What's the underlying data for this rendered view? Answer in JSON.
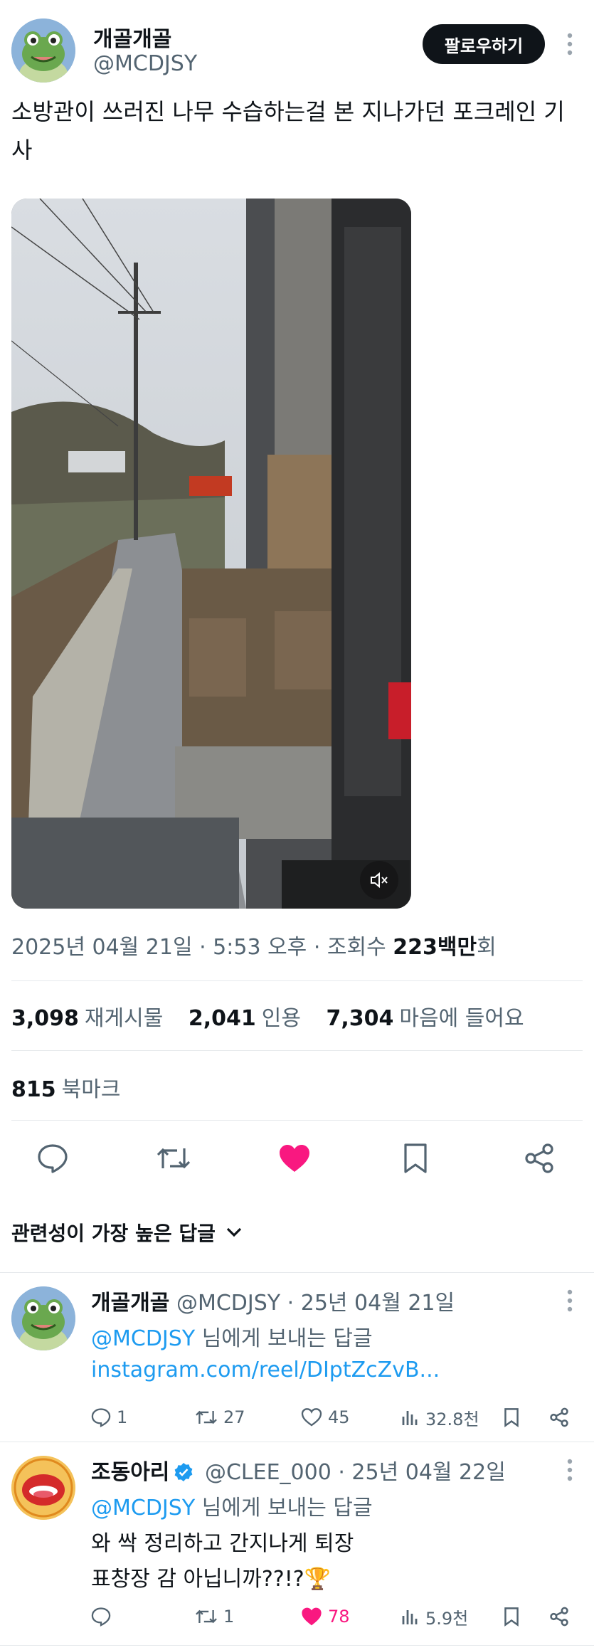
{
  "author": {
    "name": "개골개골",
    "handle": "@MCDJSY",
    "follow_label": "팔로우하기"
  },
  "tweet": {
    "text": "소방관이 쓰러진 나무 수습하는걸 본 지나가던 포크레인 기사",
    "meta_prefix": "2025년 04월 21일 · 5:53 오후 · 조회수 ",
    "views": "223백만",
    "views_suffix": "회"
  },
  "stats": {
    "reposts": "3,098",
    "reposts_label": "재게시물",
    "quotes": "2,041",
    "quotes_label": "인용",
    "likes": "7,304",
    "likes_label": "마음에 들어요",
    "bookmarks": "815",
    "bookmarks_label": "북마크"
  },
  "actions": {
    "icons": [
      "reply-icon",
      "repost-icon",
      "heart-filled-icon",
      "bookmark-icon",
      "share-icon"
    ],
    "liked_color": "#f91880"
  },
  "sort_label": "관련성이 가장 높은 답글",
  "replies": [
    {
      "name": "개골개골",
      "handle": "@MCDJSY",
      "date": "· 25년 04월 21일",
      "replying_mention": "@MCDJSY",
      "replying_text": "님에게 보내는 답글",
      "link": "instagram.com/reel/DIptZcZvB...",
      "replies": "1",
      "reposts": "27",
      "likes": "45",
      "views": "32.8천"
    },
    {
      "name": "조동아리",
      "handle": "@CLEE_000",
      "date": "· 25년 04월 22일",
      "verified": true,
      "replying_mention": "@MCDJSY",
      "replying_text": "님에게 보내는 답글",
      "line1": "와 싹 정리하고 간지나게 퇴장",
      "line2": "표창장 감 아닙니까??!?🏆",
      "replies": "",
      "reposts": "1",
      "likes": "78",
      "views": "5.9천"
    }
  ],
  "colors": {
    "accent": "#1d9bf0",
    "like": "#f91880",
    "muted": "#536471",
    "text": "#0f1419"
  }
}
